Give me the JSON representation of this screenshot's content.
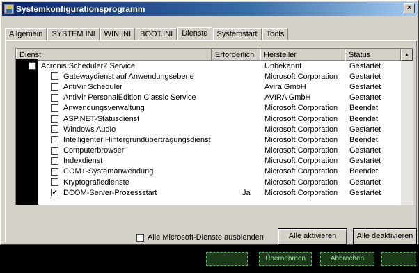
{
  "window": {
    "title": "Systemkonfigurationsprogramm",
    "close_glyph": "×"
  },
  "tabs": [
    "Allgemein",
    "SYSTEM.INI",
    "WIN.INI",
    "BOOT.INI",
    "Dienste",
    "Systemstart",
    "Tools"
  ],
  "active_tab": "Dienste",
  "columns": [
    "Dienst",
    "Erforderlich",
    "Hersteller",
    "Status"
  ],
  "services": [
    {
      "name": "Acronis Scheduler2 Service",
      "required": "",
      "manufacturer": "Unbekannt",
      "status": "Gestartet",
      "checked": false
    },
    {
      "name": "Gatewaydienst auf Anwendungsebene",
      "required": "",
      "manufacturer": "Microsoft Corporation",
      "status": "Gestartet",
      "checked": false
    },
    {
      "name": "AntiVir Scheduler",
      "required": "",
      "manufacturer": "Avira GmbH",
      "status": "Gestartet",
      "checked": false
    },
    {
      "name": "AntiVir PersonalEdition Classic Service",
      "required": "",
      "manufacturer": "AVIRA GmbH",
      "status": "Gestartet",
      "checked": false
    },
    {
      "name": "Anwendungsverwaltung",
      "required": "",
      "manufacturer": "Microsoft Corporation",
      "status": "Beendet",
      "checked": false
    },
    {
      "name": "ASP.NET-Statusdienst",
      "required": "",
      "manufacturer": "Microsoft Corporation",
      "status": "Beendet",
      "checked": false
    },
    {
      "name": "Windows Audio",
      "required": "",
      "manufacturer": "Microsoft Corporation",
      "status": "Gestartet",
      "checked": false
    },
    {
      "name": "Intelligenter Hintergrundübertragungsdienst",
      "required": "",
      "manufacturer": "Microsoft Corporation",
      "status": "Beendet",
      "checked": false
    },
    {
      "name": "Computerbrowser",
      "required": "",
      "manufacturer": "Microsoft Corporation",
      "status": "Gestartet",
      "checked": false
    },
    {
      "name": "Indexdienst",
      "required": "",
      "manufacturer": "Microsoft Corporation",
      "status": "Gestartet",
      "checked": false
    },
    {
      "name": "COM+-Systemanwendung",
      "required": "",
      "manufacturer": "Microsoft Corporation",
      "status": "Beendet",
      "checked": false
    },
    {
      "name": "Kryptografiedienste",
      "required": "",
      "manufacturer": "Microsoft Corporation",
      "status": "Gestartet",
      "checked": false
    },
    {
      "name": "DCOM-Server-Prozessstart",
      "required": "Ja",
      "manufacturer": "Microsoft Corporation",
      "status": "Gestartet",
      "checked": true
    }
  ],
  "footer": {
    "hide_ms_label": "Alle Microsoft-Dienste ausblenden",
    "enable_all": "Alle aktivieren",
    "disable_all": "Alle deaktivieren"
  },
  "bottom_buttons": [
    "",
    "Übernehmen",
    "Abbrechen",
    ""
  ],
  "icons": {
    "app": "msconfig-icon",
    "scroll_up": "arrow-up-icon",
    "check": "checkmark-icon"
  }
}
